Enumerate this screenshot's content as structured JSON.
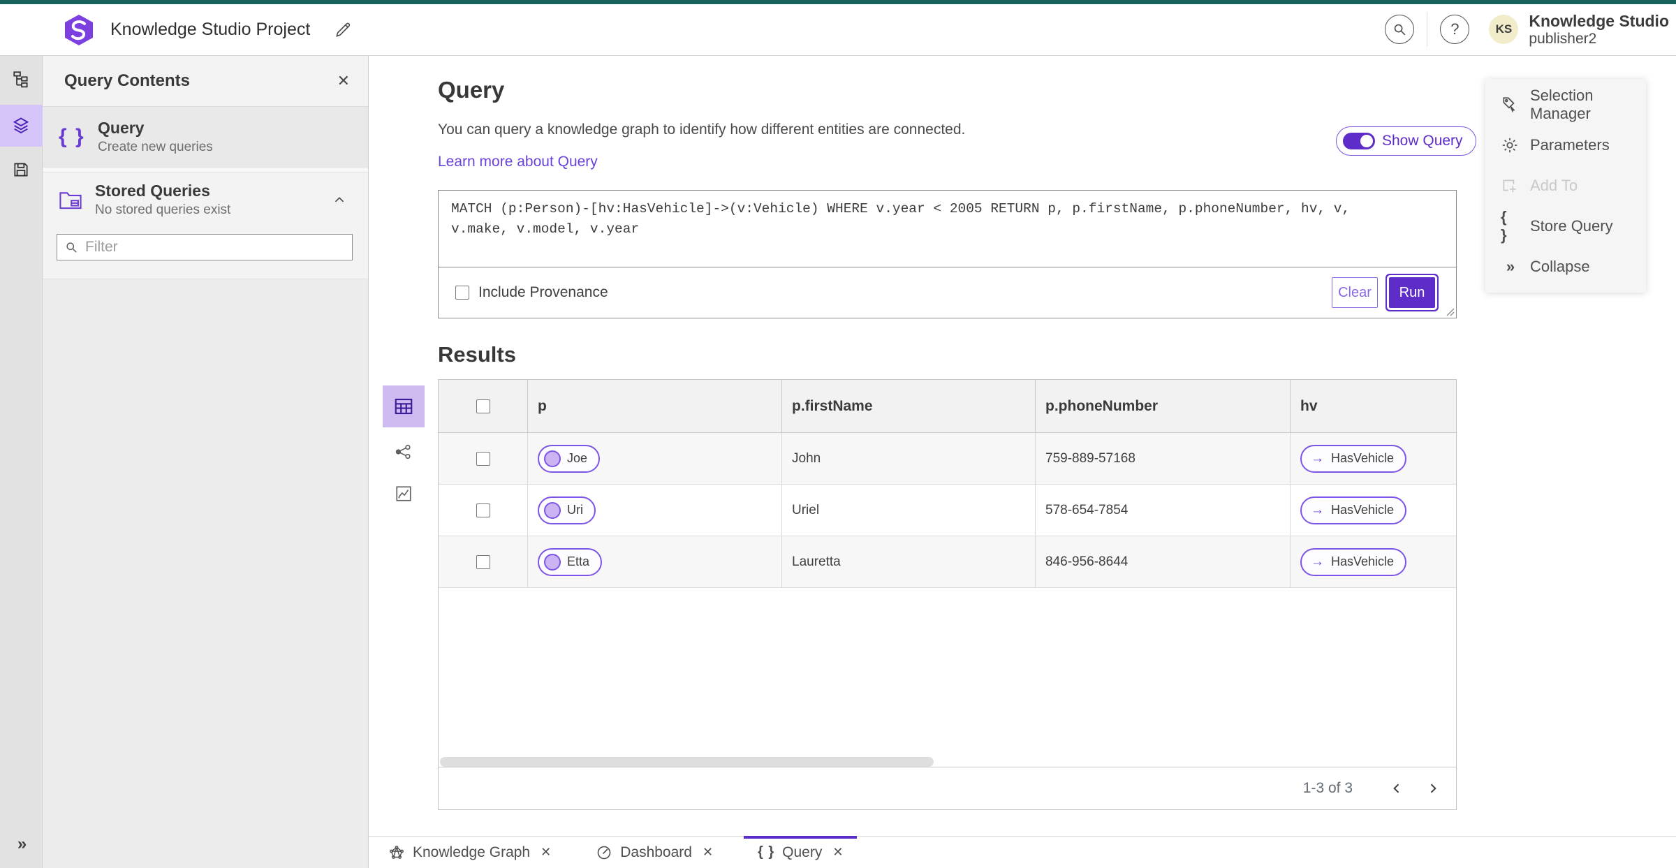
{
  "header": {
    "project_title": "Knowledge Studio Project",
    "app_name": "Knowledge Studio",
    "user_name": "publisher2",
    "avatar_initials": "KS",
    "help_glyph": "?"
  },
  "left_panel": {
    "title": "Query Contents",
    "query_item": {
      "label": "Query",
      "sublabel": "Create new queries"
    },
    "stored_item": {
      "label": "Stored Queries",
      "sublabel": "No stored queries exist"
    },
    "filter_placeholder": "Filter"
  },
  "query_section": {
    "title": "Query",
    "description": "You can query a knowledge graph to identify how different entities are connected.",
    "learn_more": "Learn more about Query",
    "show_query_label": "Show Query",
    "query_text": "MATCH (p:Person)-[hv:HasVehicle]->(v:Vehicle) WHERE v.year < 2005 RETURN p, p.firstName, p.phoneNumber, hv, v,\nv.make, v.model, v.year",
    "include_provenance_label": "Include Provenance",
    "clear_label": "Clear",
    "run_label": "Run"
  },
  "results": {
    "title": "Results",
    "columns": {
      "p": "p",
      "firstName": "p.firstName",
      "phoneNumber": "p.phoneNumber",
      "hv": "hv"
    },
    "rows": [
      {
        "p": "Joe",
        "firstName": "John",
        "phoneNumber": "759-889-57168",
        "hv": "HasVehicle"
      },
      {
        "p": "Uri",
        "firstName": "Uriel",
        "phoneNumber": "578-654-7854",
        "hv": "HasVehicle"
      },
      {
        "p": "Etta",
        "firstName": "Lauretta",
        "phoneNumber": "846-956-8644",
        "hv": "HasVehicle"
      }
    ],
    "arrow_glyph": "→",
    "pagination": "1-3 of 3"
  },
  "right_panel": {
    "selection_manager": "Selection Manager",
    "parameters": "Parameters",
    "add_to": "Add To",
    "store_query": "Store Query",
    "collapse": "Collapse"
  },
  "tabs": {
    "knowledge_graph": "Knowledge Graph",
    "dashboard": "Dashboard",
    "query": "Query",
    "close_glyph": "✕"
  },
  "glyphs": {
    "brace_icon": "{ }",
    "chevrons": "»"
  },
  "colors": {
    "accent": "#5e2cc9",
    "accent_light": "#7d55e6",
    "teal_strip": "#17635c",
    "avatar_bg": "#f1ecc9",
    "active_view_bg": "#cdbbf2"
  }
}
